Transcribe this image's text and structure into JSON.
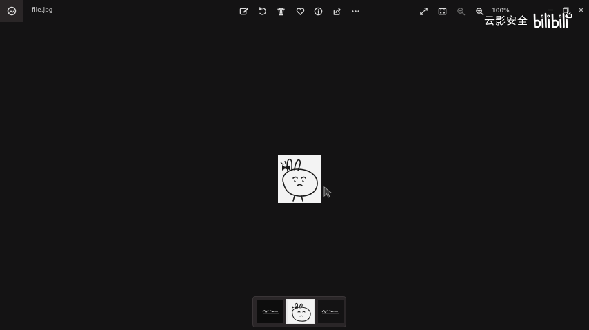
{
  "titlebar": {
    "file_name": "file.jpg",
    "app_icon": "photos-app-icon"
  },
  "toolbar": {
    "left_tools": [
      {
        "name": "edit-image-icon"
      },
      {
        "name": "rotate-icon"
      },
      {
        "name": "delete-icon"
      },
      {
        "name": "favorite-heart-icon"
      },
      {
        "name": "info-icon"
      },
      {
        "name": "share-icon"
      },
      {
        "name": "more-options-icon"
      }
    ],
    "right_tools": [
      {
        "name": "full-screen-icon"
      },
      {
        "name": "fit-to-window-icon"
      },
      {
        "name": "zoom-out-icon",
        "disabled": true
      },
      {
        "name": "zoom-in-icon"
      }
    ],
    "zoom_level": "100%"
  },
  "watermark": {
    "text": "云影安全",
    "logo": "bilibili"
  },
  "filmstrip": {
    "selected_index": 1,
    "thumbnails": [
      {
        "name": "thumbnail-1",
        "kind": "text-sketch"
      },
      {
        "name": "thumbnail-2",
        "kind": "bunny-drawing"
      },
      {
        "name": "thumbnail-3",
        "kind": "text-sketch"
      }
    ]
  },
  "colors": {
    "background": "#141314",
    "filmstrip": "#2a2628",
    "icon": "#dcdcdc"
  }
}
